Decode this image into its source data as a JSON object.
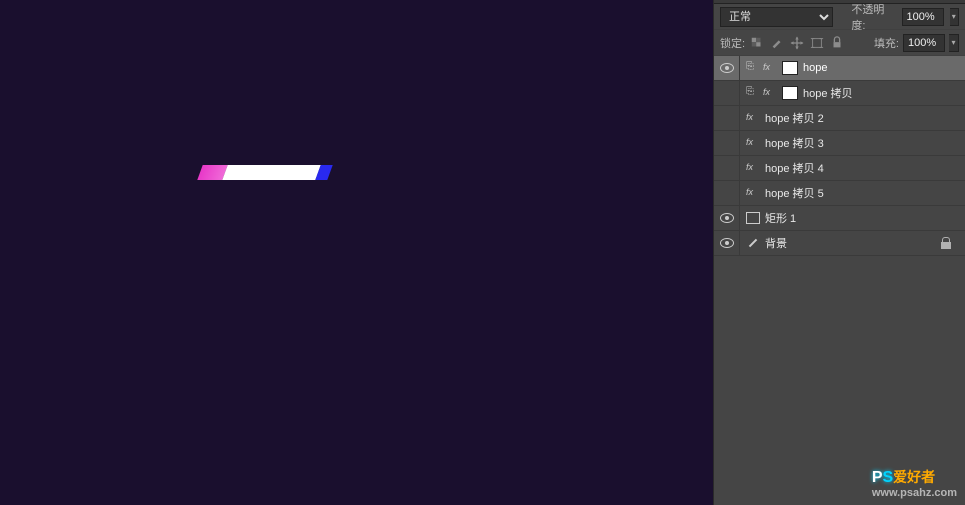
{
  "blend_modes": {
    "selected": "正常"
  },
  "opacity": {
    "label": "不透明度:",
    "value": "100%"
  },
  "lock": {
    "label": "锁定:"
  },
  "fill": {
    "label": "填充:",
    "value": "100%"
  },
  "layers": [
    {
      "name": "hope",
      "visible": true,
      "selected": true,
      "type": "text-mask"
    },
    {
      "name": "hope 拷贝",
      "visible": false,
      "selected": false,
      "type": "text-mask"
    },
    {
      "name": "hope 拷贝 2",
      "visible": false,
      "selected": false,
      "type": "text"
    },
    {
      "name": "hope 拷贝 3",
      "visible": false,
      "selected": false,
      "type": "text"
    },
    {
      "name": "hope 拷贝 4",
      "visible": false,
      "selected": false,
      "type": "text"
    },
    {
      "name": "hope 拷贝 5",
      "visible": false,
      "selected": false,
      "type": "text"
    },
    {
      "name": "矩形 1",
      "visible": true,
      "selected": false,
      "type": "rect"
    },
    {
      "name": "背景",
      "visible": true,
      "selected": false,
      "type": "bg",
      "locked": true
    }
  ],
  "watermark": {
    "brand_p": "P",
    "brand_s": "S",
    "brand_cn": "爱好者",
    "url": "www.psahz.com"
  }
}
